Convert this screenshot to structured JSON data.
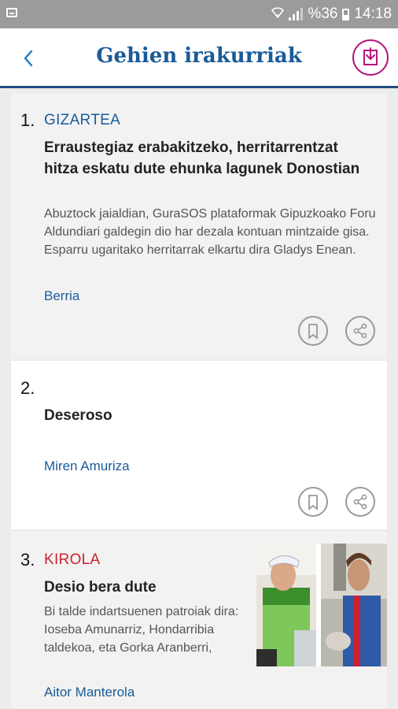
{
  "status_bar": {
    "battery_text": "%36",
    "time": "14:18"
  },
  "header": {
    "title": "Gehien irakurriak"
  },
  "colors": {
    "accent_blue": "#1a5b9a",
    "kirola_red": "#d0202e",
    "download_magenta": "#b5157f"
  },
  "articles": [
    {
      "rank": "1.",
      "section": "GIZARTEA",
      "headline": "Erraustegiaz erabakitzeko, herritarrentzat hitza eskatu dute ehunka lagunek Donostian",
      "summary": "Abuztock jaialdian, GuraSOS plataformak Gipuzkoako Foru Aldundiari galdegin dio har dezala kontuan mintzaide gisa. Esparru ugaritako herritarrak elkartu dira Gladys Enean.",
      "author": "Berria"
    },
    {
      "rank": "2.",
      "section": "",
      "headline": "Deseroso",
      "summary": "",
      "author": "Miren Amuriza"
    },
    {
      "rank": "3.",
      "section": "KIROLA",
      "headline": "Desio bera dute",
      "summary": "Bi talde indartsuenen patroiak dira: Ioseba Amunarriz, Hondarribia taldekoa, eta Gorka Aranberri,",
      "author": "Aitor Manterola"
    }
  ]
}
